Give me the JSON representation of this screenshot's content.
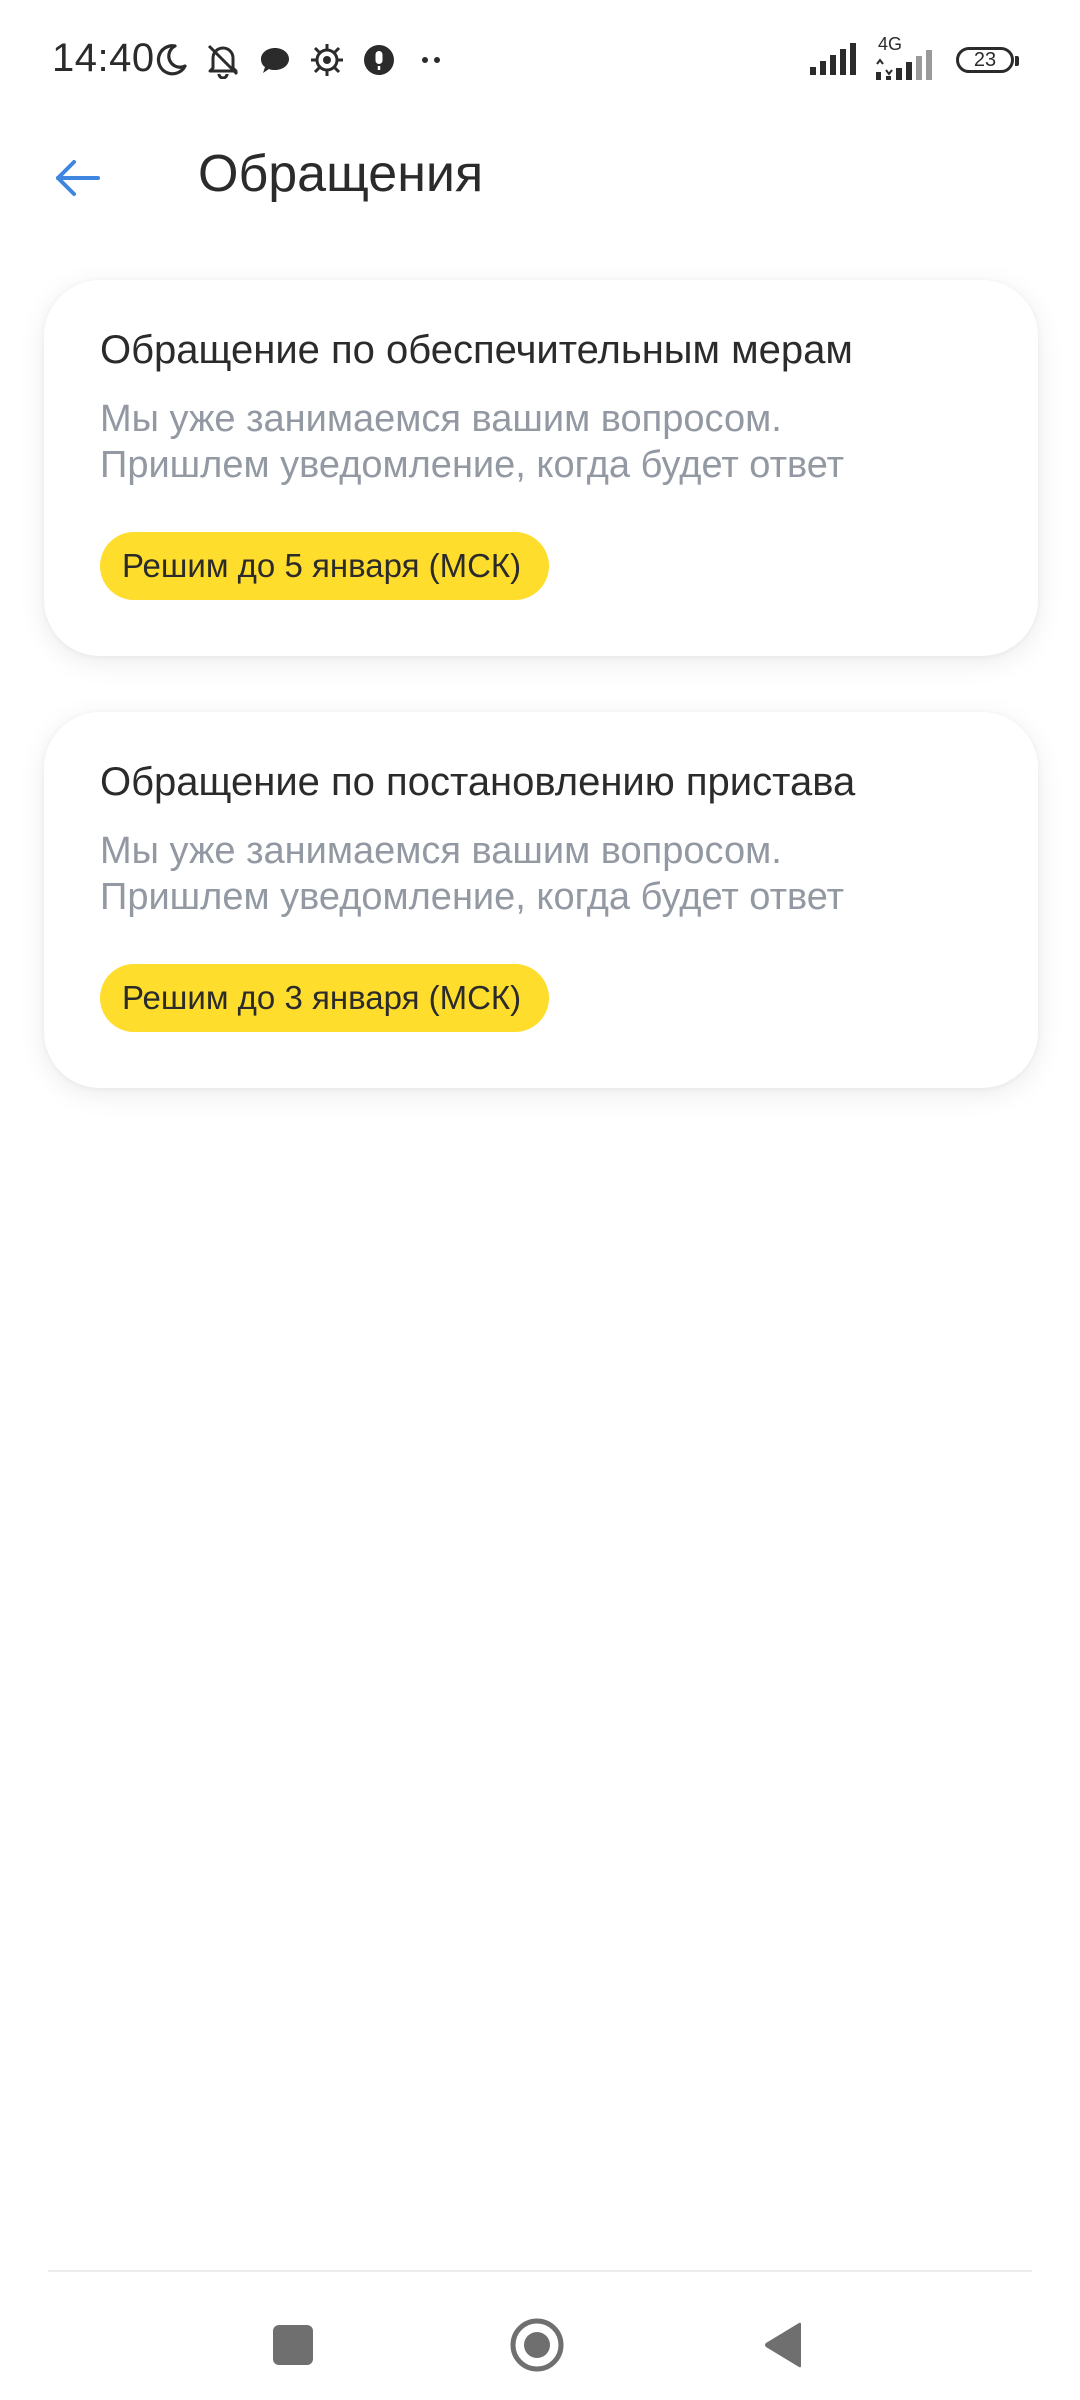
{
  "status_bar": {
    "time": "14:40",
    "network_type": "4G",
    "battery_level": "23",
    "icons_left": [
      "moon-icon",
      "bell-off-icon",
      "chat-bubble-icon",
      "settings-bug-icon",
      "microphone-icon",
      "more-dots-icon"
    ],
    "icons_right": [
      "signal-icon",
      "signal-4g-icon",
      "battery-icon"
    ]
  },
  "header": {
    "back_icon": "arrow-left-icon",
    "title": "Обращения"
  },
  "cards": [
    {
      "title": "Обращение по обеспечительным мерам",
      "text_line1": "Мы уже занимаемся вашим вопросом.",
      "text_line2": "Пришлем уведомление, когда будет ответ",
      "badge": "Решим до 5 января (МСК)"
    },
    {
      "title": "Обращение по постановлению пристава",
      "text_line1": "Мы уже занимаемся вашим вопросом.",
      "text_line2": "Пришлем уведомление, когда будет ответ",
      "badge": "Решим до 3 января (МСК)"
    }
  ],
  "nav_bar": {
    "buttons": [
      "recent-apps-icon",
      "home-icon",
      "back-triangle-icon"
    ]
  },
  "colors": {
    "accent": "#3f86e0",
    "badge": "#ffdd2d",
    "muted_text": "#9299a2",
    "text": "#2b2b2b"
  }
}
